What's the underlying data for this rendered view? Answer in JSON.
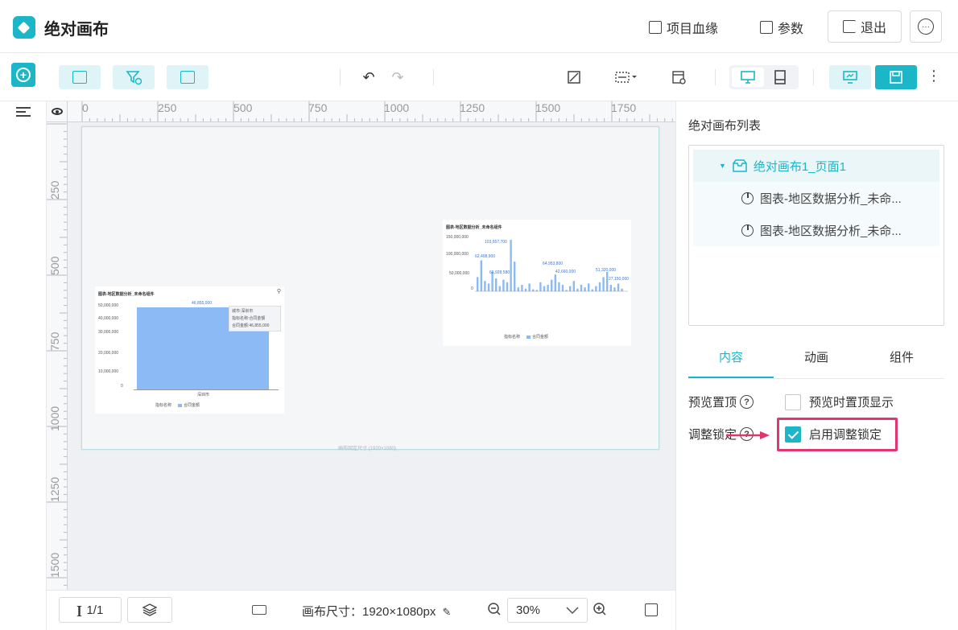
{
  "header": {
    "title": "绝对画布",
    "lineage_label": "项目血缘",
    "params_label": "参数",
    "exit_label": "退出",
    "more_label": "···"
  },
  "toolbar": {
    "undo_glyph": "↶",
    "redo_glyph": "↷"
  },
  "ruler": {
    "top_ticks": [
      "0",
      "250",
      "500",
      "750",
      "1000",
      "1250",
      "1500",
      "1750"
    ],
    "left_ticks": [
      "250",
      "500",
      "750",
      "1000",
      "1250",
      "1500"
    ]
  },
  "canvas": {
    "size_note": "画布固定尺寸 (1920×1080)",
    "left_card": {
      "title": "图表-地区数据分析_未命名组件",
      "y_ticks": [
        "50,000,000",
        "40,000,000",
        "30,000,000",
        "20,000,000",
        "10,000,000",
        "0"
      ],
      "top_value": "46,855,000",
      "tooltip_lines": [
        "城市:深圳市",
        "指标名称:合同金额",
        "合同金额:46,855,000"
      ],
      "x_label": "深圳市",
      "legend": [
        "指标名称",
        "合同金额"
      ]
    },
    "right_card": {
      "title": "图表-地区数据分析_未命名组件",
      "y_ticks": [
        "150,000,000",
        "100,000,000",
        "50,000,000",
        "0"
      ],
      "labels": [
        "103,657,700",
        "62,408,900",
        "66,928,580",
        "64,953,800",
        "51,320,000",
        "42,660,000",
        "27,150,000"
      ],
      "legend": [
        "指标名称",
        "合同金额"
      ]
    }
  },
  "bottombar": {
    "page_indicator": "1/1",
    "canvas_size_label": "画布尺寸：1920×1080px",
    "zoom_value": "30%"
  },
  "rightpanel": {
    "list_title": "绝对画布列表",
    "tree": {
      "root": "绝对画布1_页面1",
      "children": [
        "图表-地区数据分析_未命...",
        "图表-地区数据分析_未命..."
      ]
    },
    "tabs": [
      "内容",
      "动画",
      "组件"
    ],
    "props": {
      "preview_top_label": "预览置顶",
      "preview_top_option": "预览时置顶显示",
      "lock_label": "调整锁定",
      "lock_option": "启用调整锁定"
    }
  },
  "colors": {
    "accent": "#1cb6c9",
    "highlight": "#e0356e",
    "bar": "#8bbaf5"
  }
}
